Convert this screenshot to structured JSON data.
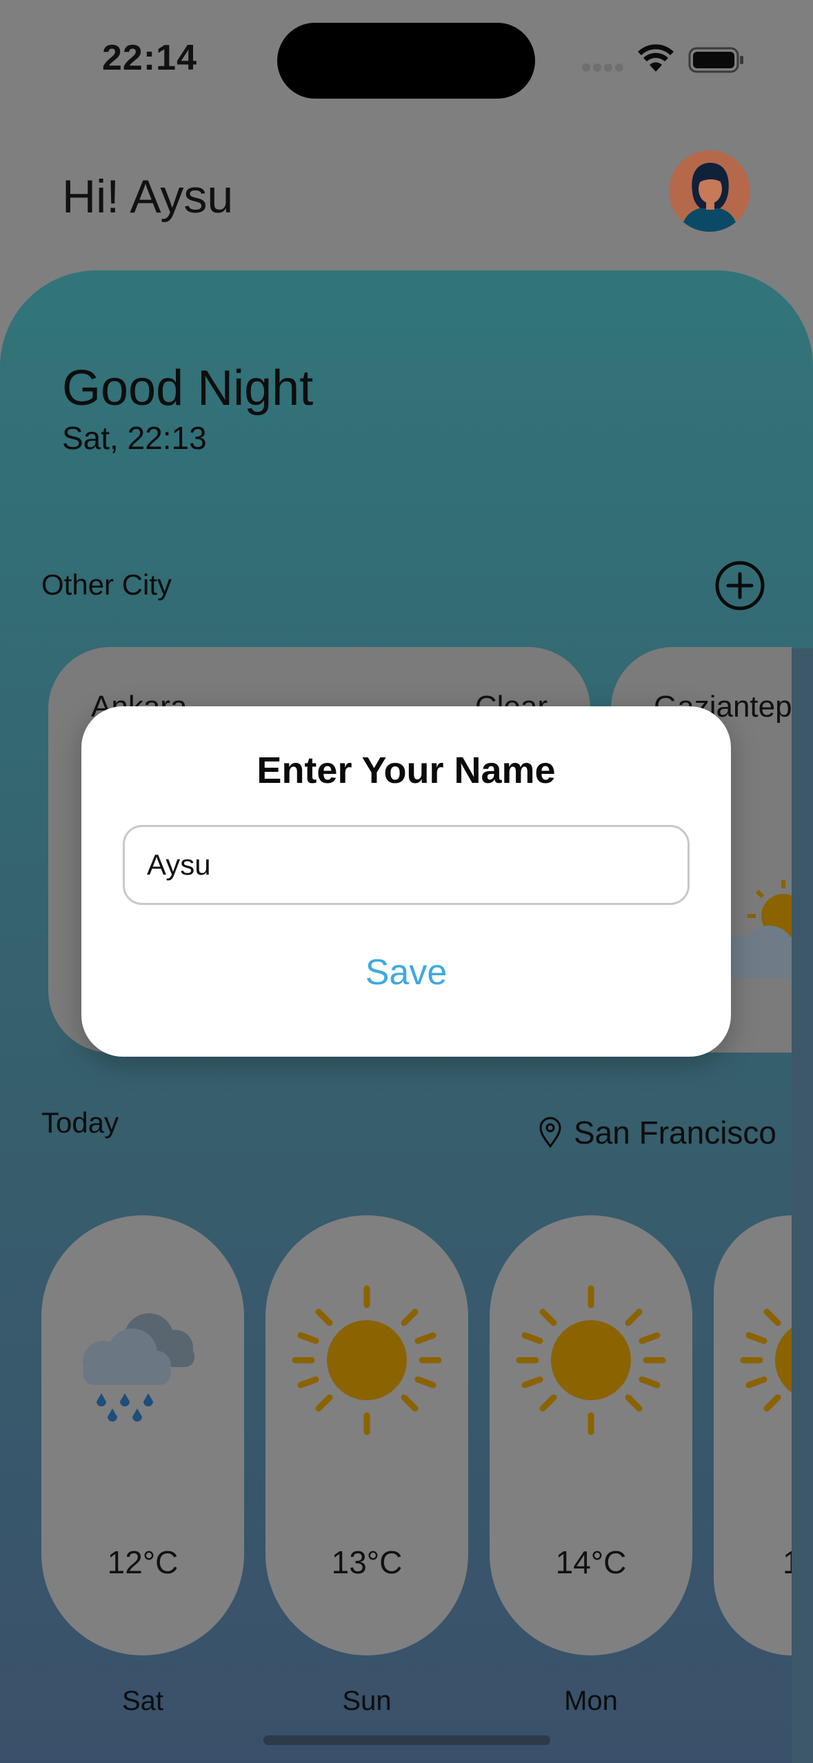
{
  "status_bar": {
    "time": "22:14"
  },
  "header": {
    "greeting": "Hi! Aysu"
  },
  "hero": {
    "title": "Good Night",
    "date": "Sat, 22:13"
  },
  "other_city": {
    "label": "Other City",
    "cards": [
      {
        "name": "Ankara",
        "condition": "Clear"
      },
      {
        "name": "Gaziantep",
        "condition": ""
      }
    ]
  },
  "today": {
    "label": "Today",
    "location": "San Francisco",
    "forecast": [
      {
        "day": "Sat",
        "temp": "12°C",
        "icon": "rain-cloud-icon"
      },
      {
        "day": "Sun",
        "temp": "13°C",
        "icon": "sun-icon"
      },
      {
        "day": "Mon",
        "temp": "14°C",
        "icon": "sun-icon"
      },
      {
        "day": "",
        "temp": "1",
        "icon": "sun-icon"
      }
    ]
  },
  "modal": {
    "title": "Enter Your Name",
    "input_value": "Aysu",
    "save_label": "Save"
  },
  "colors": {
    "accent": "#3fa9df",
    "panel_top": "#31757a",
    "panel_bottom": "#3a506a",
    "sun": "#8b6300"
  }
}
